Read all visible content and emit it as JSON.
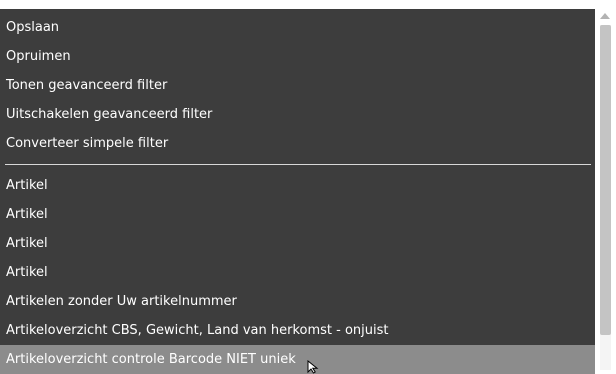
{
  "menu": {
    "items_group1": [
      {
        "label": "Opslaan"
      },
      {
        "label": "Opruimen"
      },
      {
        "label": "Tonen geavanceerd filter"
      },
      {
        "label": "Uitschakelen geavanceerd filter"
      },
      {
        "label": "Converteer simpele filter"
      }
    ],
    "items_group2": [
      {
        "label": "Artikel"
      },
      {
        "label": "Artikel"
      },
      {
        "label": "Artikel"
      },
      {
        "label": "Artikel"
      },
      {
        "label": "Artikelen zonder Uw artikelnummer"
      },
      {
        "label": "Artikeloverzicht CBS, Gewicht, Land van herkomst - onjuist"
      },
      {
        "label": "Artikeloverzicht controle Barcode NIET uniek"
      }
    ],
    "highlighted_item": "Artikeloverzicht controle Barcode NIET uniek"
  },
  "colors": {
    "panel_background": "#3d3d3d",
    "highlight_background": "#8c8c8c",
    "text": "#ffffff",
    "separator": "#d8d8d8"
  },
  "icons": {
    "scroll_up": "scroll-up-arrow-icon",
    "cursor": "mouse-pointer-icon"
  }
}
